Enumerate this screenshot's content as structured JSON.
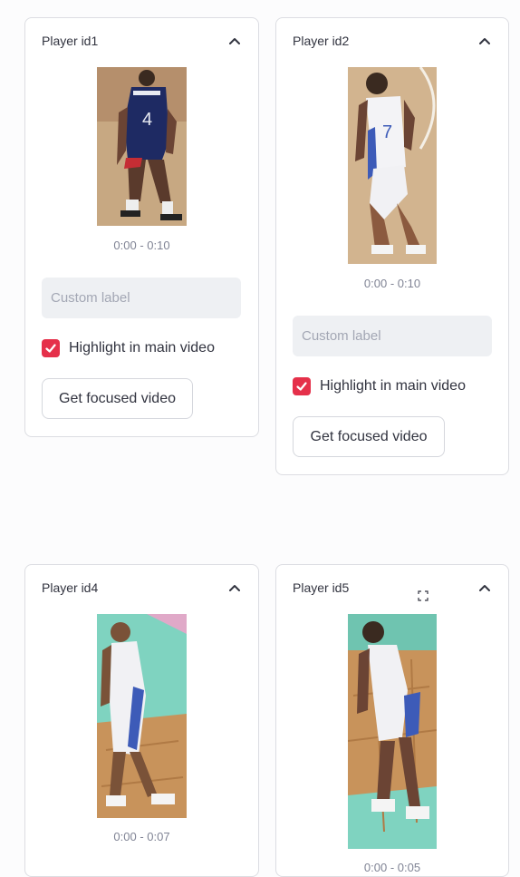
{
  "cards": [
    {
      "title": "Player id1",
      "time_range": "0:00 - 0:10",
      "input_placeholder": "Custom label",
      "checkbox_label": "Highlight in main video",
      "checkbox_checked": true,
      "button_label": "Get focused video"
    },
    {
      "title": "Player id2",
      "time_range": "0:00 - 0:10",
      "input_placeholder": "Custom label",
      "checkbox_label": "Highlight in main video",
      "checkbox_checked": true,
      "button_label": "Get focused video"
    },
    {
      "title": "Player id4",
      "time_range": "0:00 - 0:07"
    },
    {
      "title": "Player id5",
      "time_range": "0:00 - 0:05"
    }
  ],
  "icons": {
    "collapse": "chevron-up-icon",
    "checkbox": "check-icon",
    "expand": "fullscreen-icon"
  },
  "colors": {
    "accent": "#e5304a",
    "border": "#dcdde2",
    "input_bg": "#eef0f3"
  }
}
